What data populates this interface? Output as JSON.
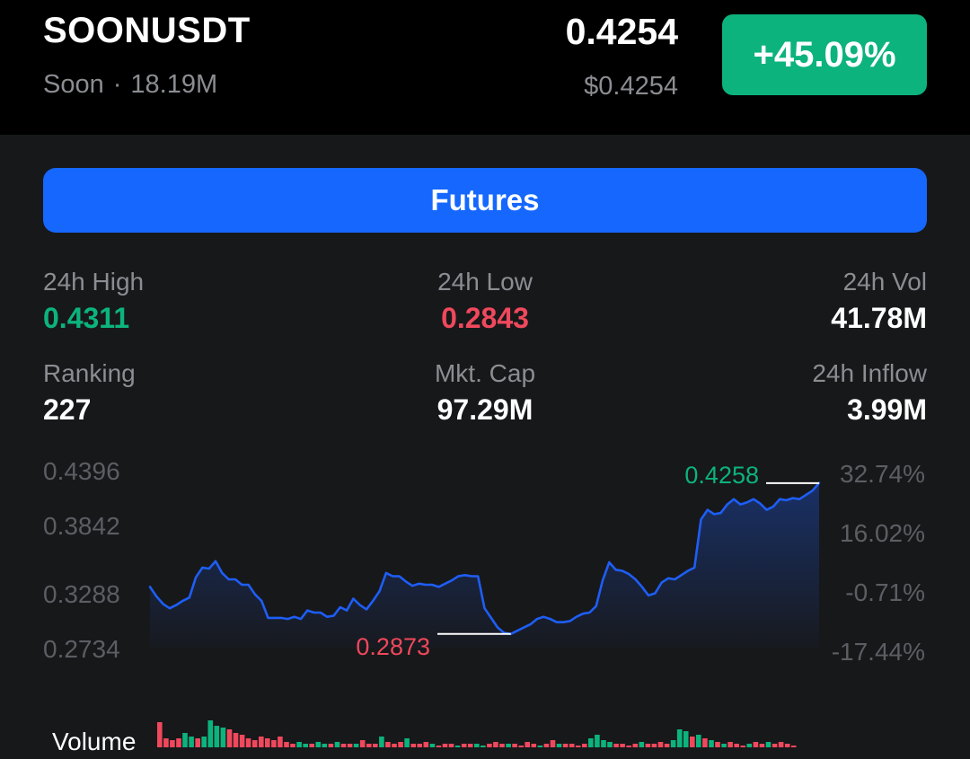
{
  "header": {
    "symbol": "SOONUSDT",
    "name": "Soon",
    "separator": "·",
    "market_volume": "18.19M",
    "price": "0.4254",
    "price_usd": "$0.4254",
    "change_percent": "+45.09%"
  },
  "futures_button": {
    "label": "Futures"
  },
  "stats": {
    "high_24h": {
      "label": "24h High",
      "value": "0.4311"
    },
    "low_24h": {
      "label": "24h Low",
      "value": "0.2843"
    },
    "vol_24h": {
      "label": "24h Vol",
      "value": "41.78M"
    },
    "ranking": {
      "label": "Ranking",
      "value": "227"
    },
    "market_cap": {
      "label": "Mkt. Cap",
      "value": "97.29M"
    },
    "inflow_24h": {
      "label": "24h Inflow",
      "value": "3.99M"
    }
  },
  "colors": {
    "up": "#0cb37d",
    "down": "#f0485c",
    "accent": "#1567fe",
    "line": "#1e5ef5"
  },
  "chart_data": {
    "type": "area",
    "price_axis": [
      "0.4396",
      "0.3842",
      "0.3288",
      "0.2734"
    ],
    "percent_axis": [
      "32.74%",
      "16.02%",
      "-0.71%",
      "-17.44%"
    ],
    "max_label": "0.4258",
    "min_label": "0.2873",
    "volume_label": "Volume",
    "y_range": [
      0.2734,
      0.4396
    ],
    "prices": [
      0.331,
      0.322,
      0.315,
      0.311,
      0.314,
      0.318,
      0.321,
      0.34,
      0.349,
      0.348,
      0.355,
      0.344,
      0.338,
      0.338,
      0.333,
      0.333,
      0.324,
      0.318,
      0.302,
      0.302,
      0.302,
      0.301,
      0.303,
      0.301,
      0.309,
      0.307,
      0.307,
      0.303,
      0.304,
      0.312,
      0.309,
      0.32,
      0.314,
      0.31,
      0.318,
      0.327,
      0.344,
      0.341,
      0.341,
      0.336,
      0.332,
      0.334,
      0.333,
      0.333,
      0.331,
      0.334,
      0.337,
      0.341,
      0.342,
      0.341,
      0.341,
      0.311,
      0.302,
      0.293,
      0.288,
      0.287,
      0.29,
      0.293,
      0.296,
      0.301,
      0.303,
      0.301,
      0.298,
      0.298,
      0.299,
      0.303,
      0.306,
      0.307,
      0.313,
      0.337,
      0.354,
      0.347,
      0.346,
      0.343,
      0.338,
      0.331,
      0.323,
      0.325,
      0.335,
      0.339,
      0.338,
      0.342,
      0.346,
      0.349,
      0.394,
      0.403,
      0.399,
      0.4,
      0.408,
      0.413,
      0.408,
      0.41,
      0.413,
      0.409,
      0.403,
      0.406,
      0.413,
      0.412,
      0.414,
      0.413,
      0.417,
      0.421,
      0.428
    ],
    "volume": [
      [
        14,
        "r"
      ],
      [
        5,
        "r"
      ],
      [
        4,
        "r"
      ],
      [
        5,
        "r"
      ],
      [
        8,
        "g"
      ],
      [
        6,
        "g"
      ],
      [
        5,
        "r"
      ],
      [
        6,
        "g"
      ],
      [
        15,
        "g"
      ],
      [
        12,
        "g"
      ],
      [
        11,
        "g"
      ],
      [
        10,
        "r"
      ],
      [
        8,
        "r"
      ],
      [
        7,
        "r"
      ],
      [
        5,
        "r"
      ],
      [
        4,
        "r"
      ],
      [
        6,
        "r"
      ],
      [
        5,
        "r"
      ],
      [
        4,
        "r"
      ],
      [
        6,
        "r"
      ],
      [
        3,
        "r"
      ],
      [
        2,
        "r"
      ],
      [
        3,
        "g"
      ],
      [
        2,
        "g"
      ],
      [
        2,
        "r"
      ],
      [
        3,
        "g"
      ],
      [
        2,
        "g"
      ],
      [
        2,
        "r"
      ],
      [
        3,
        "g"
      ],
      [
        2,
        "r"
      ],
      [
        2,
        "r"
      ],
      [
        2,
        "g"
      ],
      [
        4,
        "r"
      ],
      [
        2,
        "r"
      ],
      [
        2,
        "r"
      ],
      [
        6,
        "g"
      ],
      [
        3,
        "r"
      ],
      [
        2,
        "r"
      ],
      [
        3,
        "r"
      ],
      [
        5,
        "g"
      ],
      [
        2,
        "r"
      ],
      [
        2,
        "r"
      ],
      [
        3,
        "r"
      ],
      [
        2,
        "g"
      ],
      [
        1,
        "r"
      ],
      [
        2,
        "r"
      ],
      [
        2,
        "r"
      ],
      [
        1,
        "g"
      ],
      [
        2,
        "r"
      ],
      [
        2,
        "r"
      ],
      [
        2,
        "g"
      ],
      [
        1,
        "g"
      ],
      [
        2,
        "r"
      ],
      [
        3,
        "r"
      ],
      [
        2,
        "r"
      ],
      [
        2,
        "g"
      ],
      [
        2,
        "r"
      ],
      [
        1,
        "r"
      ],
      [
        3,
        "r"
      ],
      [
        2,
        "r"
      ],
      [
        1,
        "g"
      ],
      [
        2,
        "r"
      ],
      [
        4,
        "r"
      ],
      [
        2,
        "g"
      ],
      [
        2,
        "r"
      ],
      [
        2,
        "r"
      ],
      [
        1,
        "r"
      ],
      [
        2,
        "r"
      ],
      [
        5,
        "g"
      ],
      [
        7,
        "g"
      ],
      [
        4,
        "g"
      ],
      [
        3,
        "g"
      ],
      [
        2,
        "r"
      ],
      [
        2,
        "r"
      ],
      [
        1,
        "r"
      ],
      [
        2,
        "r"
      ],
      [
        3,
        "g"
      ],
      [
        2,
        "r"
      ],
      [
        2,
        "r"
      ],
      [
        3,
        "r"
      ],
      [
        2,
        "r"
      ],
      [
        4,
        "g"
      ],
      [
        10,
        "g"
      ],
      [
        9,
        "g"
      ],
      [
        6,
        "r"
      ],
      [
        7,
        "g"
      ],
      [
        5,
        "r"
      ],
      [
        4,
        "g"
      ],
      [
        3,
        "r"
      ],
      [
        2,
        "g"
      ],
      [
        3,
        "r"
      ],
      [
        2,
        "r"
      ],
      [
        1,
        "r"
      ],
      [
        2,
        "g"
      ],
      [
        3,
        "r"
      ],
      [
        2,
        "r"
      ],
      [
        3,
        "g"
      ],
      [
        2,
        "r"
      ],
      [
        3,
        "r"
      ],
      [
        2,
        "r"
      ],
      [
        1,
        "r"
      ]
    ]
  }
}
